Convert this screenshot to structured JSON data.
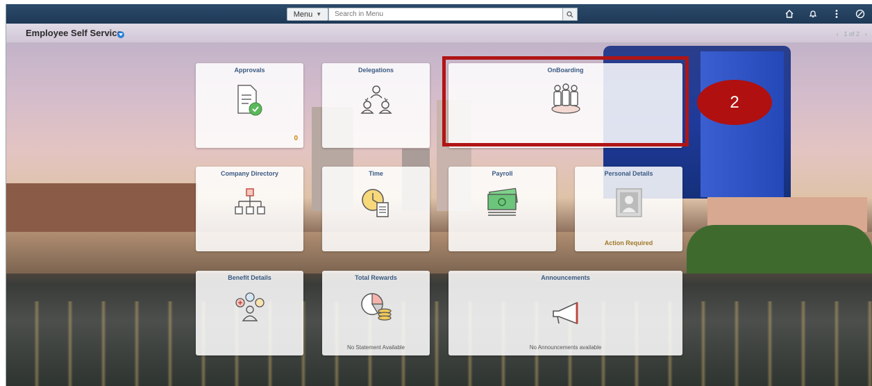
{
  "topbar": {
    "menu_label": "Menu",
    "search_placeholder": "Search in Menu",
    "icons": [
      "home-icon",
      "bell-icon",
      "kebab-icon",
      "nav-circle-icon"
    ]
  },
  "header": {
    "title": "Employee Self Service",
    "pager": "1 of 2"
  },
  "tiles": [
    {
      "title": "Approvals",
      "icon": "document-check-icon",
      "count": "0"
    },
    {
      "title": "Delegations",
      "icon": "delegation-icon"
    },
    {
      "title": "OnBoarding",
      "icon": "onboarding-icon"
    },
    {
      "title": "Company Directory",
      "icon": "org-chart-icon"
    },
    {
      "title": "Time",
      "icon": "clock-timesheet-icon"
    },
    {
      "title": "Payroll",
      "icon": "money-icon"
    },
    {
      "title": "Personal Details",
      "icon": "person-card-icon",
      "status": "Action Required"
    },
    {
      "title": "Benefit Details",
      "icon": "benefits-icon"
    },
    {
      "title": "Total Rewards",
      "icon": "pie-coins-icon",
      "note": "No Statement Available"
    },
    {
      "title": "Announcements",
      "icon": "megaphone-icon",
      "note": "No Announcements available"
    }
  ],
  "annotation": {
    "step": "2"
  },
  "colors": {
    "topbar": "#1e3956",
    "tile_title": "#3a5a82",
    "annotation": "#b01515",
    "count": "#c8860a"
  }
}
